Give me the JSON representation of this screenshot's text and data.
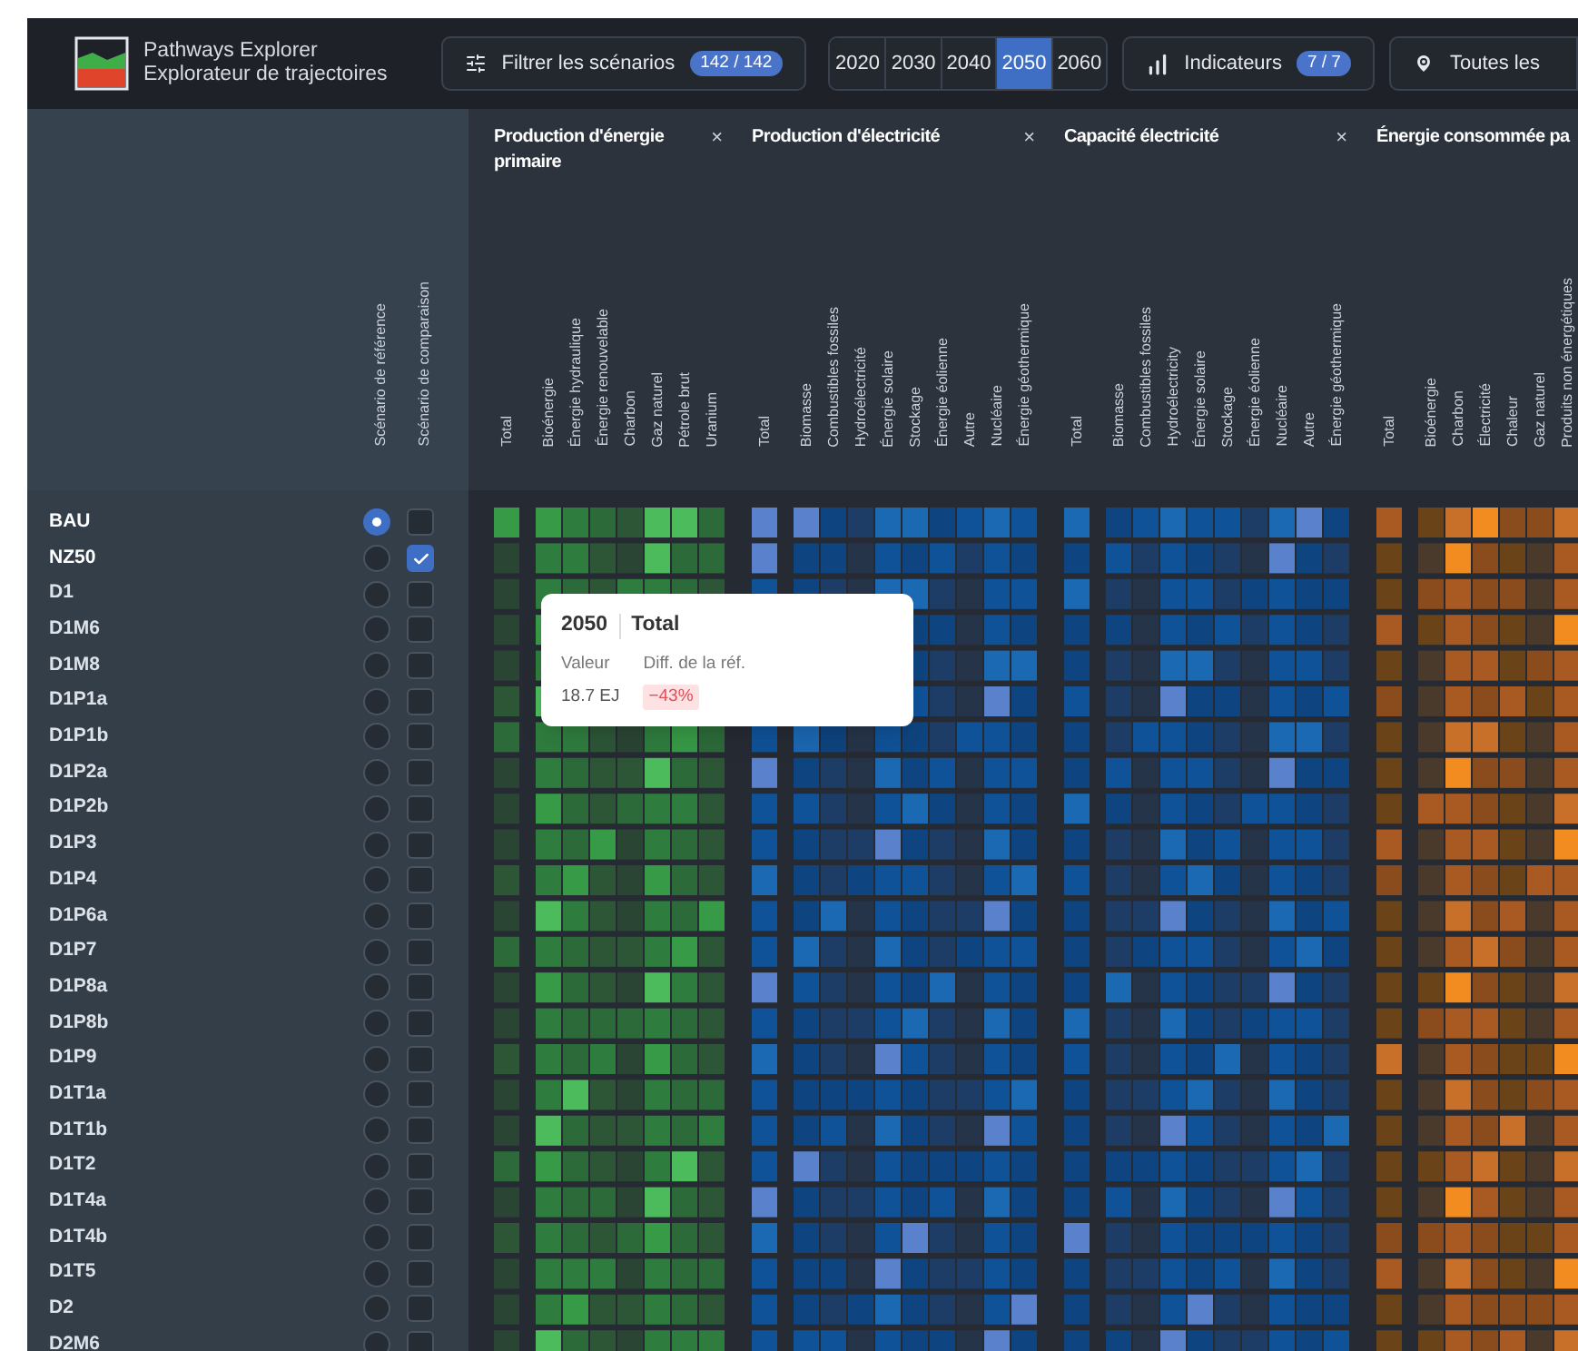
{
  "header": {
    "app_name": "Pathways Explorer",
    "app_subtitle": "Explorateur de trajectoires",
    "filter": {
      "label": "Filtrer les scénarios",
      "count": "142 / 142"
    },
    "years": [
      {
        "label": "2020",
        "selected": false
      },
      {
        "label": "2030",
        "selected": false
      },
      {
        "label": "2040",
        "selected": false
      },
      {
        "label": "2050",
        "selected": true
      },
      {
        "label": "2060",
        "selected": false
      }
    ],
    "indicators": {
      "label": "Indicateurs",
      "count": "7 / 7"
    },
    "region": {
      "label": "Toutes les"
    }
  },
  "scenario_columns": [
    "Scénario de référence",
    "Scénario de comparaison"
  ],
  "groups": [
    {
      "title": "Production d'énergie primaire",
      "close": "×",
      "columns": [
        "Total",
        "Bioénergie",
        "Énergie hydraulique",
        "Énergie renouvelable",
        "Charbon",
        "Gaz naturel",
        "Pétrole brut",
        "Uranium"
      ]
    },
    {
      "title": "Production d'électricité",
      "close": "×",
      "columns": [
        "Total",
        "Biomasse",
        "Combustibles fossiles",
        "Hydroélectricité",
        "Énergie solaire",
        "Stockage",
        "Énergie éolienne",
        "Autre",
        "Nucléaire",
        "Énergie géothermique"
      ]
    },
    {
      "title": "Capacité électricité",
      "close": "×",
      "columns": [
        "Total",
        "Biomasse",
        "Combustibles fossiles",
        "Hydroélectricity",
        "Énergie solaire",
        "Stockage",
        "Énergie éolienne",
        "Nucléaire",
        "Autre",
        "Énergie géothermique"
      ]
    },
    {
      "title": "Énergie consommée pa",
      "columns": [
        "Total",
        "Bioénergie",
        "Charbon",
        "Électricité",
        "Chaleur",
        "Gaz naturel",
        "Produits non énergétiques"
      ]
    }
  ],
  "scenarios": [
    {
      "name": "BAU",
      "selected": true,
      "checked": false
    },
    {
      "name": "NZ50",
      "selected": false,
      "checked": true
    },
    {
      "name": "D1",
      "selected": false,
      "checked": false
    },
    {
      "name": "D1M6",
      "selected": false,
      "checked": false
    },
    {
      "name": "D1M8",
      "selected": false,
      "checked": false
    },
    {
      "name": "D1P1a",
      "selected": false,
      "checked": false
    },
    {
      "name": "D1P1b",
      "selected": false,
      "checked": false
    },
    {
      "name": "D1P2a",
      "selected": false,
      "checked": false
    },
    {
      "name": "D1P2b",
      "selected": false,
      "checked": false
    },
    {
      "name": "D1P3",
      "selected": false,
      "checked": false
    },
    {
      "name": "D1P4",
      "selected": false,
      "checked": false
    },
    {
      "name": "D1P6a",
      "selected": false,
      "checked": false
    },
    {
      "name": "D1P7",
      "selected": false,
      "checked": false
    },
    {
      "name": "D1P8a",
      "selected": false,
      "checked": false
    },
    {
      "name": "D1P8b",
      "selected": false,
      "checked": false
    },
    {
      "name": "D1P9",
      "selected": false,
      "checked": false
    },
    {
      "name": "D1T1a",
      "selected": false,
      "checked": false
    },
    {
      "name": "D1T1b",
      "selected": false,
      "checked": false
    },
    {
      "name": "D1T2",
      "selected": false,
      "checked": false
    },
    {
      "name": "D1T4a",
      "selected": false,
      "checked": false
    },
    {
      "name": "D1T4b",
      "selected": false,
      "checked": false
    },
    {
      "name": "D1T5",
      "selected": false,
      "checked": false
    },
    {
      "name": "D2",
      "selected": false,
      "checked": false
    },
    {
      "name": "D2M6",
      "selected": false,
      "checked": false
    }
  ],
  "tooltip": {
    "year": "2050",
    "indicator": "Total",
    "value_label": "Valeur",
    "diff_label": "Diff. de la réf.",
    "value": "18.7 EJ",
    "diff": "−43%"
  }
}
